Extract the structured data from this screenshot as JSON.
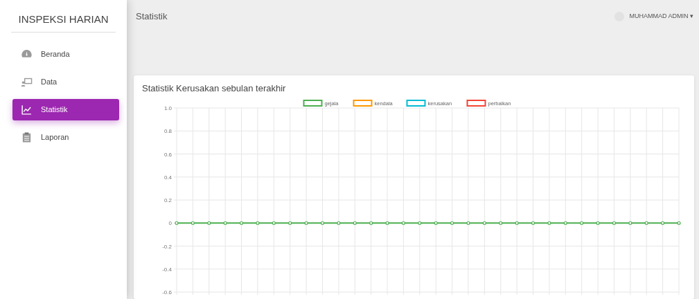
{
  "sidebar": {
    "title": "INSPEKSI HARIAN",
    "items": [
      {
        "label": "Beranda",
        "selected": false
      },
      {
        "label": "Data",
        "selected": false
      },
      {
        "label": "Statistik",
        "selected": true
      },
      {
        "label": "Laporan",
        "selected": false
      }
    ]
  },
  "topbar": {
    "title": "Statistik",
    "user": "MUHAMMAD ADMIN",
    "user_caret": "▾"
  },
  "card": {
    "title": "Statistik Kerusakan sebulan terakhir",
    "chart_data": {
      "type": "line",
      "grid": true,
      "legend": true,
      "ylim": [
        -0.6,
        1.0
      ],
      "yticks": [
        {
          "value": 1.0,
          "label": "1.0"
        },
        {
          "value": 0.8,
          "label": "0.8"
        },
        {
          "value": 0.6,
          "label": "0.6"
        },
        {
          "value": 0.4,
          "label": "0.4"
        },
        {
          "value": 0.2,
          "label": "0.2"
        },
        {
          "value": 0,
          "label": "0"
        },
        {
          "value": -0.2,
          "label": "-0.2"
        },
        {
          "value": -0.4,
          "label": "-0.4"
        },
        {
          "value": -0.6,
          "label": "-0.6"
        }
      ],
      "series": [
        {
          "name": "gejala",
          "color": "#4caf50",
          "marker": "circle",
          "values": [
            0,
            0,
            0,
            0,
            0,
            0,
            0,
            0,
            0,
            0,
            0,
            0,
            0,
            0,
            0,
            0,
            0,
            0,
            0,
            0,
            0,
            0,
            0,
            0,
            0,
            0,
            0,
            0,
            0,
            0,
            0,
            0
          ]
        },
        {
          "name": "kendala",
          "color": "#ff9800",
          "values": [
            null,
            null,
            null,
            null,
            null,
            null,
            null,
            null,
            null,
            null,
            null,
            null,
            null,
            null,
            null,
            null,
            null,
            null,
            null,
            null,
            null,
            null,
            null,
            null,
            null,
            null,
            null,
            null,
            null,
            null,
            null,
            null
          ]
        },
        {
          "name": "kerusakan",
          "color": "#00bcd4",
          "values": [
            null,
            null,
            null,
            null,
            null,
            null,
            null,
            null,
            null,
            null,
            null,
            null,
            null,
            null,
            null,
            null,
            null,
            null,
            null,
            null,
            null,
            null,
            null,
            null,
            null,
            null,
            null,
            null,
            null,
            null,
            null,
            null
          ]
        },
        {
          "name": "perbaikan",
          "color": "#f44336",
          "values": [
            null,
            null,
            null,
            null,
            null,
            null,
            null,
            null,
            null,
            null,
            null,
            null,
            null,
            null,
            null,
            null,
            null,
            null,
            null,
            null,
            null,
            null,
            null,
            null,
            null,
            null,
            null,
            null,
            null,
            null,
            null,
            null
          ]
        }
      ]
    }
  }
}
